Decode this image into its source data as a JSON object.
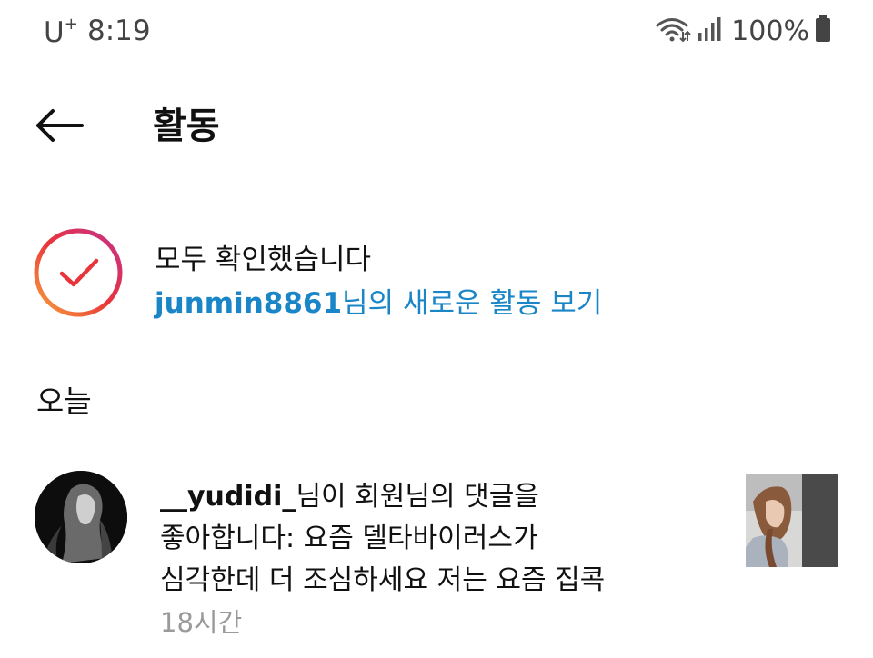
{
  "status_bar": {
    "carrier": "U",
    "carrier_sup": "+",
    "time": "8:19",
    "battery_percent": "100%",
    "icons": [
      "wifi-icon",
      "signal-icon",
      "battery-icon"
    ]
  },
  "header": {
    "back_icon": "arrow-left-icon",
    "title": "활동"
  },
  "caught_up": {
    "icon": "check-circle-icon",
    "title": "모두 확인했습니다",
    "link_username": "junmin8861",
    "link_suffix": "님의 새로운 활동 보기"
  },
  "sections": {
    "today": "오늘"
  },
  "activity": {
    "username": "__yudidi_",
    "line1_suffix": "님이 회원님의 댓글을",
    "line2": "좋아합니다: 요즘 델타바이러스가",
    "line3": "심각한데 더 조심하세요 저는 요즘 집콕",
    "time": "18시간",
    "avatar": "profile-photo",
    "thumbnail": "post-thumbnail"
  },
  "colors": {
    "link_blue": "#1a86c7",
    "time_gray": "#9a9a9a",
    "check_red": "#e8343b",
    "ring_gradient": [
      "#f8a33a",
      "#e8343b",
      "#c5308c"
    ]
  }
}
